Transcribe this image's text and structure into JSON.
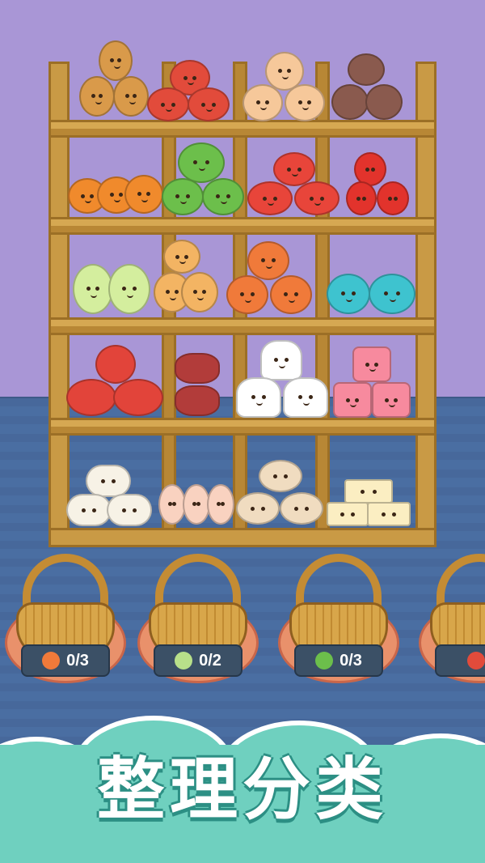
{
  "game": {
    "title": "整理分类"
  },
  "shelf_items": [
    [
      "potato",
      "tomato",
      "onion",
      "mushroom"
    ],
    [
      "carrot",
      "broccoli",
      "crab",
      "chili"
    ],
    [
      "cabbage",
      "ginger",
      "octopus",
      "pufferfish"
    ],
    [
      "shrimp",
      "meat",
      "onigiri",
      "jelly-cube"
    ],
    [
      "sushi-roll",
      "egg",
      "clam",
      "tofu"
    ]
  ],
  "baskets": [
    {
      "icon": "octopus-icon",
      "count": "0/3",
      "color": "#f07a3a"
    },
    {
      "icon": "cabbage-icon",
      "count": "0/2",
      "color": "#b8e08a"
    },
    {
      "icon": "broccoli-icon",
      "count": "0/3",
      "color": "#6cbf4b"
    },
    {
      "icon": "tomato-icon",
      "count": "",
      "color": "#e24b3b"
    }
  ],
  "colors": {
    "wall": "#a996d6",
    "floor": "#47689b",
    "wood": "#c99a45",
    "banner": "#6fd0bf"
  }
}
